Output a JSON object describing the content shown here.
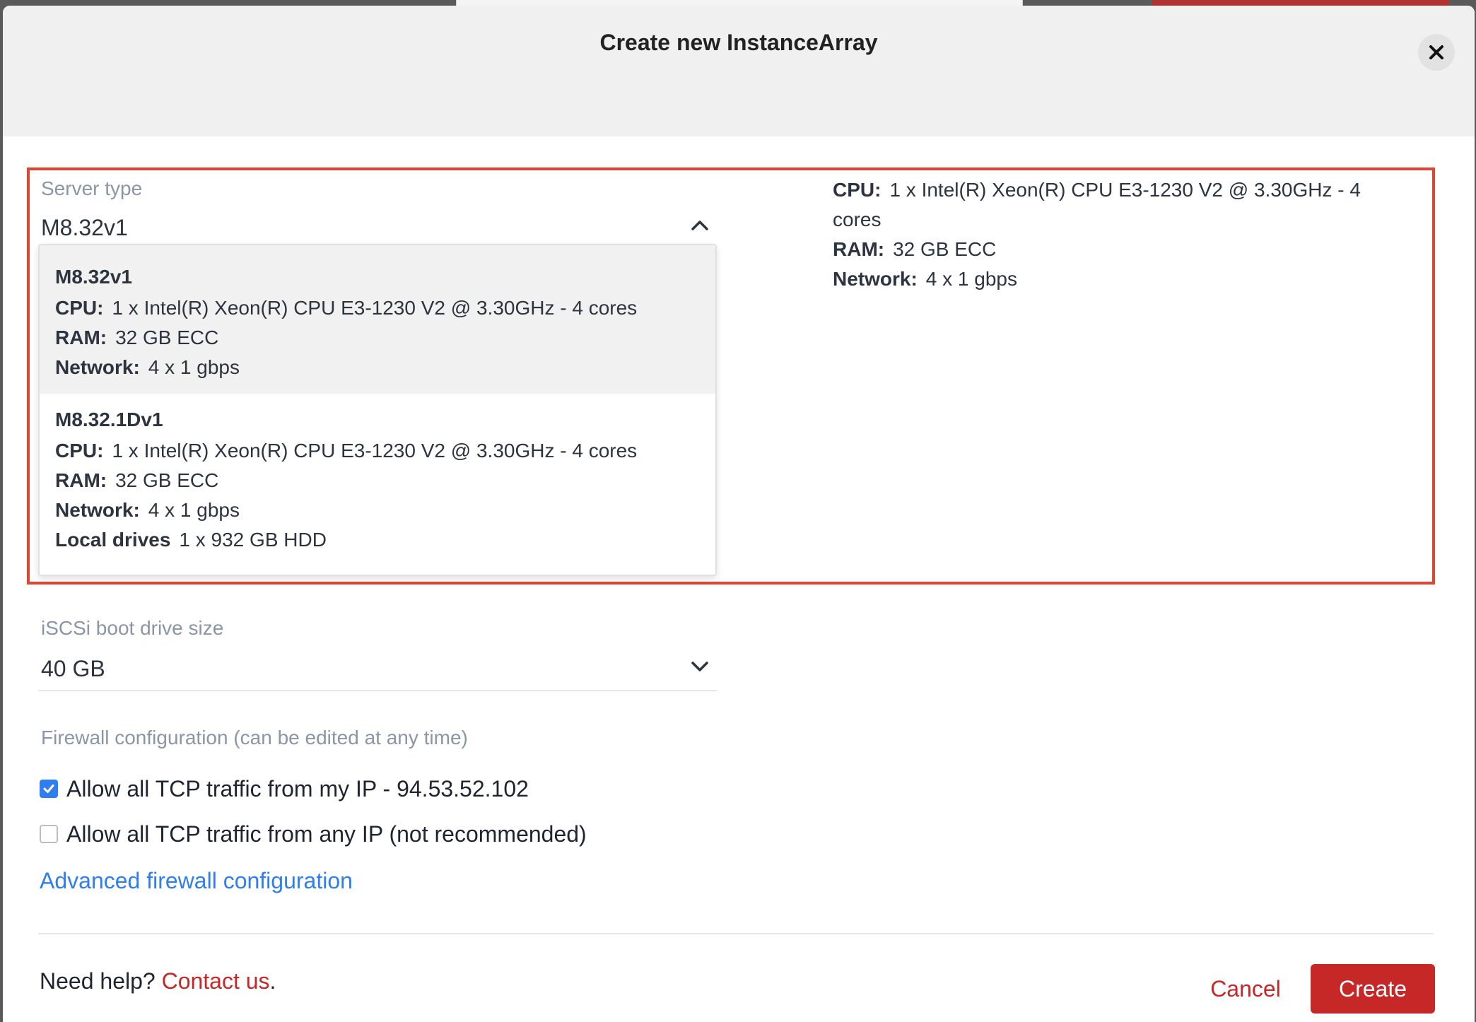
{
  "modal": {
    "title": "Create new InstanceArray"
  },
  "server_type": {
    "label": "Server type",
    "selected": "M8.32v1",
    "summary": {
      "cpu_key": "CPU:",
      "cpu_val": "1 x Intel(R) Xeon(R) CPU E3-1230 V2 @ 3.30GHz - 4 cores",
      "ram_key": "RAM:",
      "ram_val": "32 GB ECC",
      "net_key": "Network:",
      "net_val": "4 x 1 gbps"
    },
    "options": [
      {
        "name": "M8.32v1",
        "cpu_key": "CPU:",
        "cpu_val": "1 x Intel(R) Xeon(R) CPU E3-1230 V2 @ 3.30GHz - 4 cores",
        "ram_key": "RAM:",
        "ram_val": "32 GB ECC",
        "net_key": "Network:",
        "net_val": "4 x 1 gbps"
      },
      {
        "name": "M8.32.1Dv1",
        "cpu_key": "CPU:",
        "cpu_val": "1 x Intel(R) Xeon(R) CPU E3-1230 V2 @ 3.30GHz - 4 cores",
        "ram_key": "RAM:",
        "ram_val": "32 GB ECC",
        "net_key": "Network:",
        "net_val": "4 x 1 gbps",
        "drives_key": "Local drives",
        "drives_val": "1 x 932 GB HDD"
      }
    ]
  },
  "boot_drive": {
    "label": "iSCSi boot drive size",
    "value": "40 GB"
  },
  "firewall": {
    "label": "Firewall configuration (can be edited at any time)",
    "allow_my_ip": {
      "label": "Allow all TCP traffic from my IP - 94.53.52.102",
      "checked": true
    },
    "allow_any_ip": {
      "label": "Allow all TCP traffic from any IP (not recommended)",
      "checked": false
    },
    "advanced_link": "Advanced firewall configuration"
  },
  "footer": {
    "help_prefix": "Need help? ",
    "contact_link": "Contact us",
    "help_suffix": ".",
    "cancel_label": "Cancel",
    "create_label": "Create"
  },
  "colors": {
    "accent_red": "#c62828",
    "link_blue": "#2f7ef0",
    "highlight_border": "#e0452f"
  }
}
